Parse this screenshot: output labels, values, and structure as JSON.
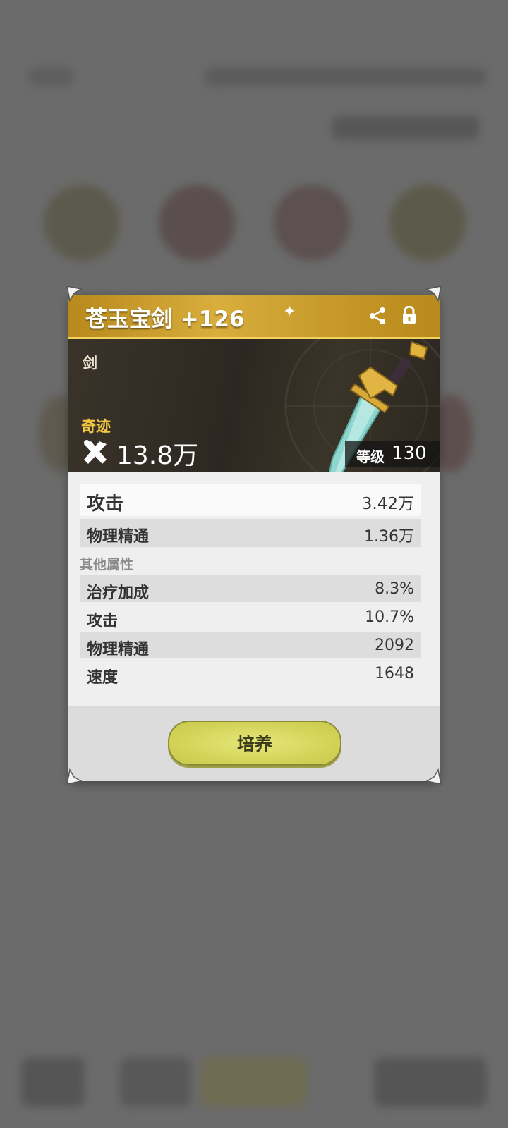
{
  "weapon": {
    "title": "苍玉宝剑 +126",
    "type": "剑",
    "rarity": "奇迹",
    "power": "13.8万",
    "level_label": "等级",
    "level_value": "130"
  },
  "main_stats": [
    {
      "name": "攻击",
      "value": "3.42万"
    },
    {
      "name": "物理精通",
      "value": "1.36万"
    }
  ],
  "other_header": "其他属性",
  "other_stats": [
    {
      "name": "治疗加成",
      "value": "8.3%"
    },
    {
      "name": "攻击",
      "value": "10.7%"
    },
    {
      "name": "物理精通",
      "value": "2092"
    },
    {
      "name": "速度",
      "value": "1648"
    }
  ],
  "button": {
    "cultivate": "培养"
  },
  "colors": {
    "rarity": "#f4c740",
    "button": "#d4d45a",
    "title_bar": "#c79a2a"
  },
  "icons": [
    "share-icon",
    "lock-icon",
    "power-icon",
    "sword-icon"
  ]
}
